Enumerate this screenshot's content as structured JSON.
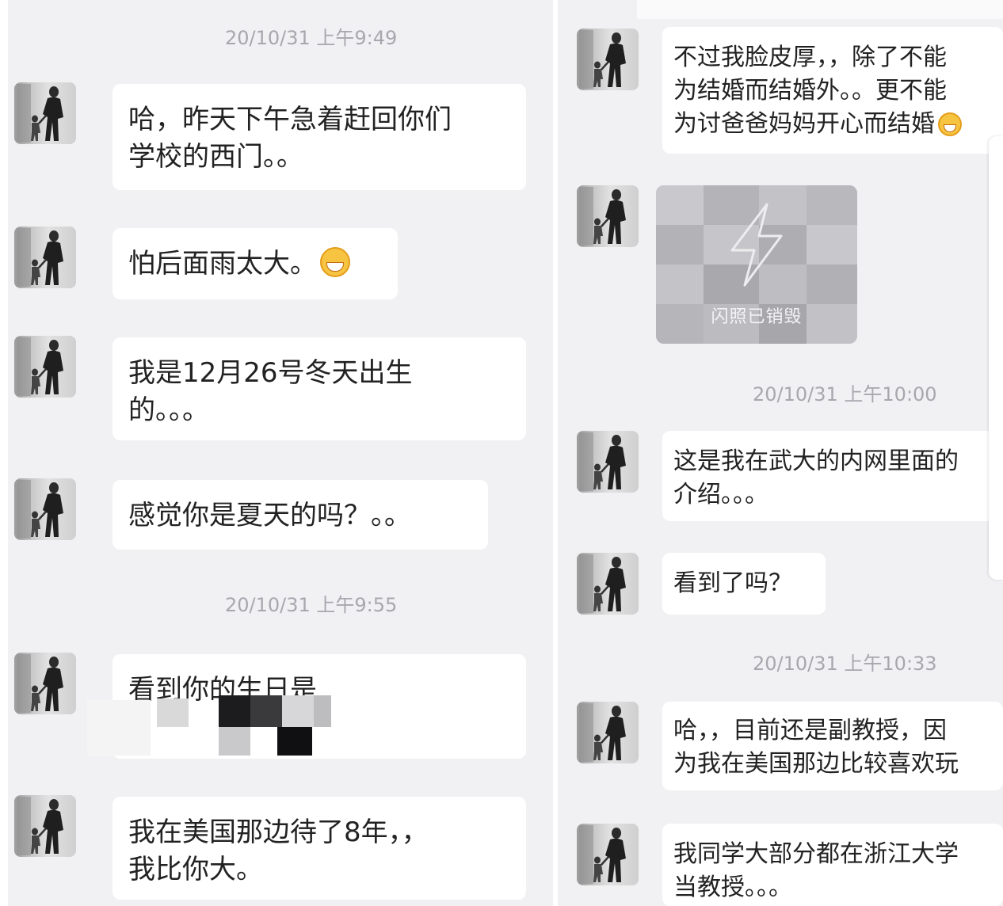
{
  "left": {
    "timestamps": [
      "20/10/31 上午9:49",
      "20/10/31 上午9:55"
    ],
    "messages": [
      {
        "lines": [
          "哈，昨天下午急着赶回你们",
          "学校的西门。。"
        ]
      },
      {
        "lines": [
          "怕后面雨太大。"
        ],
        "emoji": "grinning-face-emoji"
      },
      {
        "lines": [
          "我是12月26号冬天出生",
          "的。。。"
        ]
      },
      {
        "lines": [
          "感觉你是夏天的吗？。。"
        ]
      },
      {
        "lines": [
          "看到你的生日是"
        ],
        "redacted": true
      },
      {
        "lines": [
          "我在美国那边待了8年，，",
          "我比你大。"
        ]
      }
    ]
  },
  "right": {
    "timestamps": [
      "20/10/31 上午10:00",
      "20/10/31 上午10:33"
    ],
    "messages": [
      {
        "lines": [
          "不过我脸皮厚，，除了不能",
          "为结婚而结婚外。。更不能",
          "为讨爸爸妈妈开心而结婚"
        ],
        "emoji": "grinning-face-emoji"
      },
      {
        "image": {
          "label": "闪照已销毁",
          "icon": "lightning-bolt-icon"
        }
      },
      {
        "lines": [
          "这是我在武大的内网里面的",
          "介绍。。。"
        ]
      },
      {
        "lines": [
          "看到了吗？"
        ]
      },
      {
        "lines": [
          "哈，，目前还是副教授，因",
          "为我在美国那边比较喜欢玩"
        ]
      },
      {
        "lines": [
          "我同学大部分都在浙江大学",
          "当教授。。。"
        ]
      }
    ]
  },
  "colors": {
    "background": "#f1f1f4",
    "bubble": "#ffffff",
    "text": "#222222",
    "timestamp": "#a7a7ad"
  }
}
